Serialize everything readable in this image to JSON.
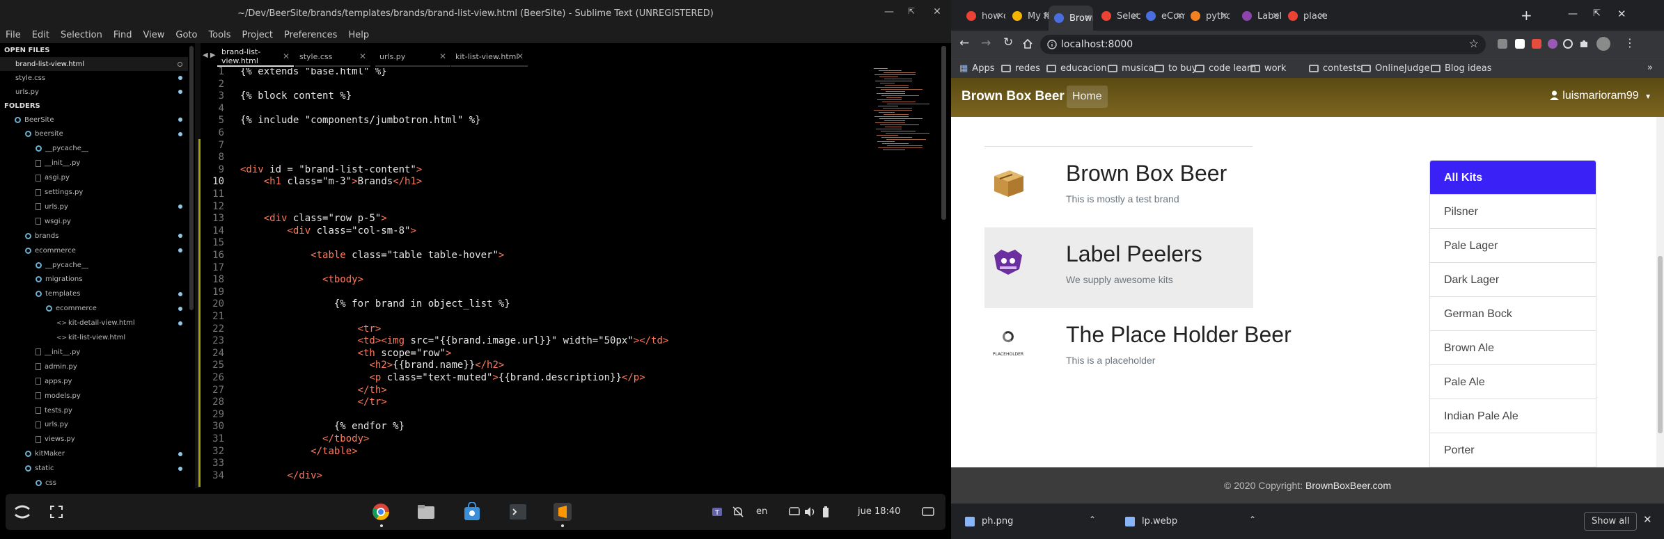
{
  "sublime": {
    "title": "~/Dev/BeerSite/brands/templates/brands/brand-list-view.html (BeerSite) - Sublime Text (UNREGISTERED)",
    "menu": [
      "File",
      "Edit",
      "Selection",
      "Find",
      "View",
      "Goto",
      "Tools",
      "Project",
      "Preferences",
      "Help"
    ],
    "sidebar": {
      "open_files_label": "OPEN FILES",
      "open_files": [
        "brand-list-view.html",
        "style.css",
        "urls.py"
      ],
      "folders_label": "FOLDERS",
      "tree": [
        {
          "label": "BeerSite",
          "depth": 1,
          "type": "folder"
        },
        {
          "label": "beersite",
          "depth": 2,
          "type": "folder"
        },
        {
          "label": "__pycache__",
          "depth": 3,
          "type": "folder"
        },
        {
          "label": "__init__.py",
          "depth": 3,
          "type": "file"
        },
        {
          "label": "asgi.py",
          "depth": 3,
          "type": "file"
        },
        {
          "label": "settings.py",
          "depth": 3,
          "type": "file"
        },
        {
          "label": "urls.py",
          "depth": 3,
          "type": "file"
        },
        {
          "label": "wsgi.py",
          "depth": 3,
          "type": "file"
        },
        {
          "label": "brands",
          "depth": 2,
          "type": "folder"
        },
        {
          "label": "ecommerce",
          "depth": 2,
          "type": "folder"
        },
        {
          "label": "__pycache__",
          "depth": 3,
          "type": "folder"
        },
        {
          "label": "migrations",
          "depth": 3,
          "type": "folder"
        },
        {
          "label": "templates",
          "depth": 3,
          "type": "folder"
        },
        {
          "label": "ecommerce",
          "depth": 4,
          "type": "folder"
        },
        {
          "label": "kit-detail-view.html",
          "depth": 5,
          "type": "code"
        },
        {
          "label": "kit-list-view.html",
          "depth": 5,
          "type": "code"
        },
        {
          "label": "__init__.py",
          "depth": 3,
          "type": "file"
        },
        {
          "label": "admin.py",
          "depth": 3,
          "type": "file"
        },
        {
          "label": "apps.py",
          "depth": 3,
          "type": "file"
        },
        {
          "label": "models.py",
          "depth": 3,
          "type": "file"
        },
        {
          "label": "tests.py",
          "depth": 3,
          "type": "file"
        },
        {
          "label": "urls.py",
          "depth": 3,
          "type": "file"
        },
        {
          "label": "views.py",
          "depth": 3,
          "type": "file"
        },
        {
          "label": "kitMaker",
          "depth": 2,
          "type": "folder"
        },
        {
          "label": "static",
          "depth": 2,
          "type": "folder"
        },
        {
          "label": "css",
          "depth": 3,
          "type": "folder"
        }
      ]
    },
    "tabs": [
      "brand-list-view.html",
      "style.css",
      "urls.py",
      "kit-list-view.html"
    ],
    "code_lines": [
      {
        "n": "1",
        "t": "{% extends \"base.html\" %}"
      },
      {
        "n": "2",
        "t": ""
      },
      {
        "n": "3",
        "t": "{% block content %}"
      },
      {
        "n": "4",
        "t": ""
      },
      {
        "n": "5",
        "t": "{% include \"components/jumbotron.html\" %}"
      },
      {
        "n": "6",
        "t": ""
      },
      {
        "n": "7",
        "t": ""
      },
      {
        "n": "8",
        "t": ""
      },
      {
        "n": "9",
        "t": "<div id = \"brand-list-content\">"
      },
      {
        "n": "10",
        "t": "    <h1 class=\"m-3\">Brands</h1>"
      },
      {
        "n": "11",
        "t": ""
      },
      {
        "n": "12",
        "t": ""
      },
      {
        "n": "13",
        "t": "    <div class=\"row p-5\">"
      },
      {
        "n": "14",
        "t": "        <div class=\"col-sm-8\">"
      },
      {
        "n": "15",
        "t": ""
      },
      {
        "n": "16",
        "t": "            <table class=\"table table-hover\">"
      },
      {
        "n": "17",
        "t": ""
      },
      {
        "n": "18",
        "t": "              <tbody>"
      },
      {
        "n": "19",
        "t": ""
      },
      {
        "n": "20",
        "t": "                {% for brand in object_list %}"
      },
      {
        "n": "21",
        "t": ""
      },
      {
        "n": "22",
        "t": "                    <tr>"
      },
      {
        "n": "23",
        "t": "                    <td><img src=\"{{brand.image.url}}\" width=\"50px\"></td>"
      },
      {
        "n": "24",
        "t": "                    <th scope=\"row\">"
      },
      {
        "n": "25",
        "t": "                      <h2>{{brand.name}}</h2>"
      },
      {
        "n": "26",
        "t": "                      <p class=\"text-muted\">{{brand.description}}</p>"
      },
      {
        "n": "27",
        "t": "                    </th>"
      },
      {
        "n": "28",
        "t": "                    </tr>"
      },
      {
        "n": "29",
        "t": ""
      },
      {
        "n": "30",
        "t": "                {% endfor %}"
      },
      {
        "n": "31",
        "t": "              </tbody>"
      },
      {
        "n": "32",
        "t": "            </table>"
      },
      {
        "n": "33",
        "t": ""
      },
      {
        "n": "34",
        "t": "        </div>"
      }
    ]
  },
  "taskbar": {
    "lang": "en",
    "clock": "jue 18:40"
  },
  "chrome": {
    "tabs": [
      {
        "label": "how d",
        "color": "#ea4335"
      },
      {
        "label": "My fir",
        "color": "#f4b400"
      },
      {
        "label": "Brown",
        "color": "#4a6ee0"
      },
      {
        "label": "Selec",
        "color": "#ea4335"
      },
      {
        "label": "eCom",
        "color": "#4a6ee0"
      },
      {
        "label": "pytho",
        "color": "#f48024"
      },
      {
        "label": "Label",
        "color": "#8e44ad"
      },
      {
        "label": "place",
        "color": "#ea4335"
      }
    ],
    "url": "localhost:8000",
    "bookmarks": [
      {
        "label": "Apps",
        "folder": false
      },
      {
        "label": "redes",
        "folder": true
      },
      {
        "label": "educacion",
        "folder": true
      },
      {
        "label": "musica",
        "folder": true
      },
      {
        "label": "to buy",
        "folder": true
      },
      {
        "label": "code learn",
        "folder": true
      },
      {
        "label": "work",
        "folder": true
      },
      {
        "label": "contests",
        "folder": true
      },
      {
        "label": "OnlineJudge",
        "folder": true
      },
      {
        "label": "Blog ideas",
        "folder": true
      }
    ],
    "downloads": [
      "ph.png",
      "lp.webp"
    ],
    "show_all": "Show all"
  },
  "site": {
    "brand": "Brown Box Beer",
    "nav_home": "Home",
    "user": "luismarioram99",
    "brands": [
      {
        "name": "Brown Box Beer",
        "description": "This is mostly a test brand"
      },
      {
        "name": "Label Peelers",
        "description": "We supply awesome kits"
      },
      {
        "name": "The Place Holder Beer",
        "description": "This is a placeholder"
      }
    ],
    "placeholder_logo_text": "PLACEHOLDER",
    "kits": [
      "All Kits",
      "Pilsner",
      "Pale Lager",
      "Dark Lager",
      "German Bock",
      "Brown Ale",
      "Pale Ale",
      "Indian Pale Ale",
      "Porter"
    ],
    "footer_prefix": "© 2020 Copyright:",
    "footer_link": "BrownBoxBeer.com"
  }
}
